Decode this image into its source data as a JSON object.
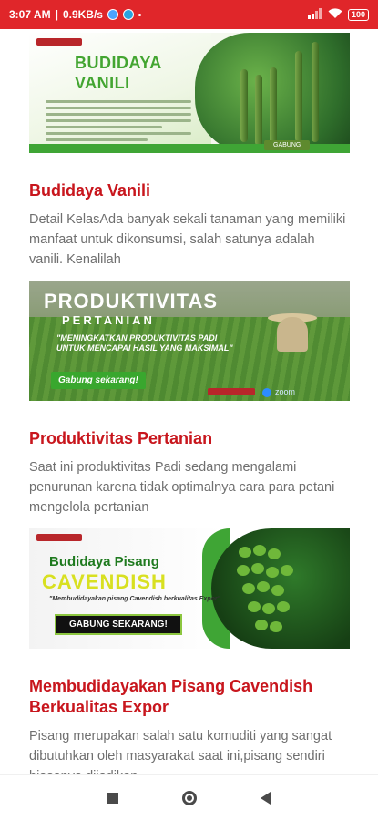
{
  "status_bar": {
    "time": "3:07 AM",
    "speed": "0.9KB/s",
    "battery": "100"
  },
  "articles": [
    {
      "banner_heading_1": "BUDIDAYA",
      "banner_heading_2": "VANILI",
      "banner_button": "GABUNG",
      "title": "Budidaya Vanili",
      "description": "Detail KelasAda banyak sekali tanaman yang memiliki manfaat untuk dikonsumsi, salah satunya adalah vanili. Kenalilah"
    },
    {
      "banner_heading_1": "PRODUKTIVITAS",
      "banner_heading_2": "PERTANIAN",
      "banner_quote": "\"MENINGKATKAN PRODUKTIVITAS PADI UNTUK MENCAPAI HASIL YANG MAKSIMAL\"",
      "banner_button": "Gabung sekarang!",
      "banner_partner": "zoom",
      "title": "Produktivitas Pertanian",
      "description": "Saat ini produktivitas Padi sedang mengalami penurunan karena tidak optimalnya cara para petani mengelola pertanian"
    },
    {
      "banner_heading_1": "Budidaya Pisang",
      "banner_heading_2": "CAVENDISH",
      "banner_sub": "\"Membudidayakan pisang Cavendish berkualitas Expor\"",
      "banner_button": "GABUNG SEKARANG!",
      "title": "Membudidayakan Pisang Cavendish Berkualitas Expor",
      "description": "Pisang merupakan salah satu komuditi yang sangat dibutuhkan oleh masyarakat saat ini,pisang sendiri biasanya dijadikan"
    }
  ],
  "colors": {
    "status_bar": "#e0262a",
    "title_red": "#c8161d",
    "desc_gray": "#6f6f6f",
    "brand_green": "#3fa535"
  },
  "icons": [
    "messenger-icon",
    "telegram-icon",
    "signal-icon",
    "wifi-icon",
    "battery-icon",
    "recent-apps-icon",
    "home-icon",
    "back-icon"
  ]
}
